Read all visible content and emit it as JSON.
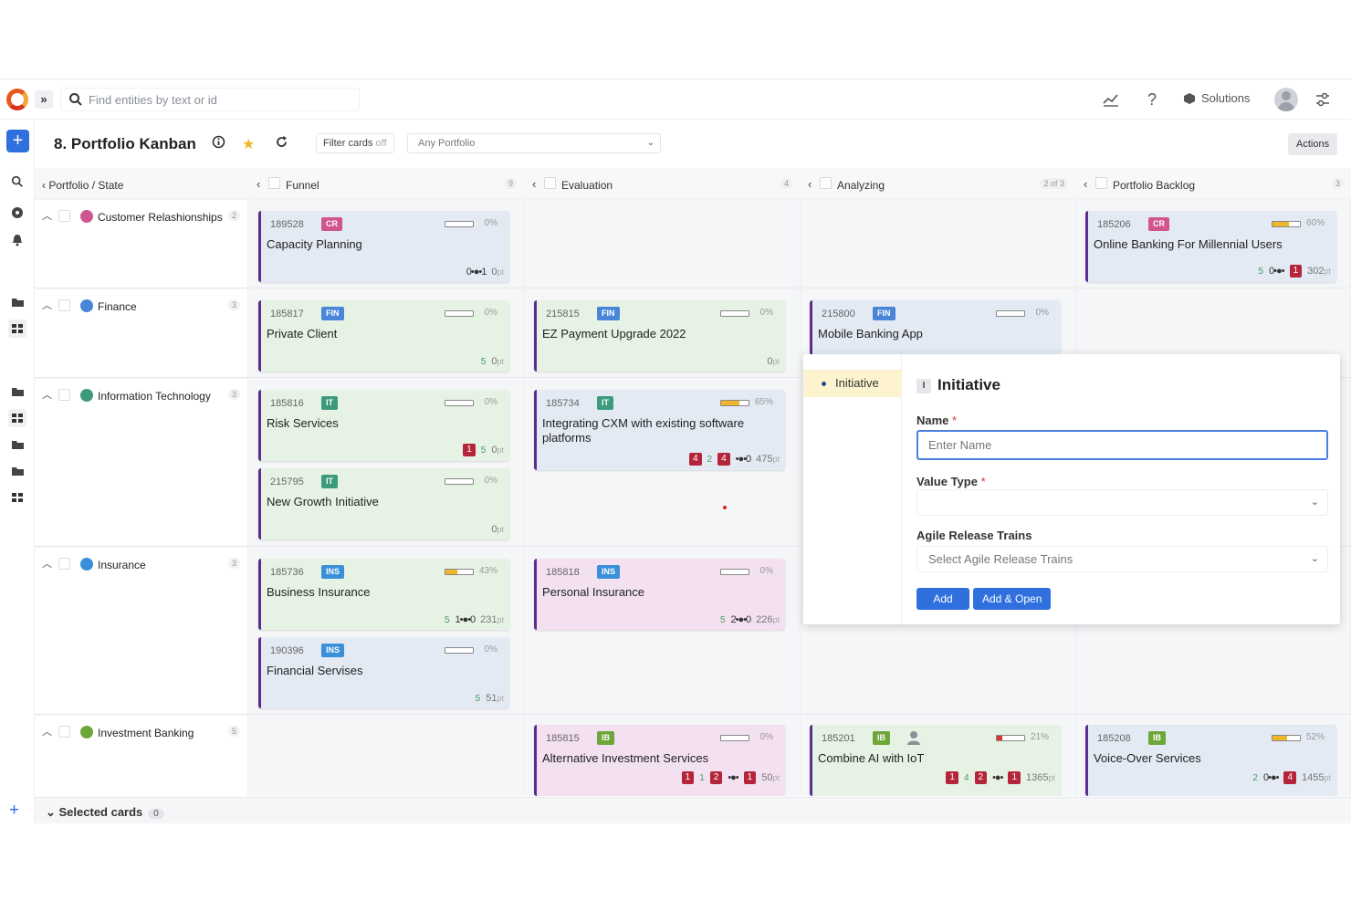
{
  "topbar": {
    "search_placeholder": "Find entities by text or id",
    "solutions_label": "Solutions",
    "icons": [
      "logo-icon",
      "expand-icon",
      "search-icon",
      "chart-icon",
      "help-icon",
      "solutions-icon",
      "avatar",
      "settings-icon"
    ]
  },
  "header": {
    "title": "8. Portfolio Kanban",
    "filter_label": "Filter cards",
    "filter_state": "off",
    "portfolio_select": "Any Portfolio",
    "actions_label": "Actions"
  },
  "board": {
    "row_header": "Portfolio / State",
    "columns": [
      {
        "label": "Funnel",
        "count": "9"
      },
      {
        "label": "Evaluation",
        "count": "4"
      },
      {
        "label": "Analyzing",
        "count": "2 of 3"
      },
      {
        "label": "Portfolio Backlog",
        "count": "3"
      }
    ],
    "lanes": [
      {
        "name": "Customer Relashionships",
        "count": "2",
        "color": "#d0558f"
      },
      {
        "name": "Finance",
        "count": "3",
        "color": "#4a86d8"
      },
      {
        "name": "Information Technology",
        "count": "3",
        "color": "#3e9a7c"
      },
      {
        "name": "Insurance",
        "count": "3",
        "color": "#3a8fd9"
      },
      {
        "name": "Investment Banking",
        "count": "5",
        "color": "#6ea63a"
      }
    ]
  },
  "cards": [
    {
      "id": "189528",
      "tag": "CR",
      "tag_color": "#d0558f",
      "pct": "0%",
      "progress": 0,
      "title": "Capacity Planning",
      "chain": "0•●•1",
      "points": "0",
      "unit": "pt"
    },
    {
      "id": "185206",
      "tag": "CR",
      "tag_color": "#d0558f",
      "pct": "60%",
      "progress": 60,
      "title": "Online Banking For Millennial Users",
      "g": "5",
      "chain": "0•●•",
      "red": "1",
      "points": "302",
      "unit": "pt"
    },
    {
      "id": "185817",
      "tag": "FIN",
      "tag_color": "#4a86d8",
      "pct": "0%",
      "progress": 0,
      "title": "Private Client",
      "g": "5",
      "points": "0",
      "unit": "pt"
    },
    {
      "id": "215815",
      "tag": "FIN",
      "tag_color": "#4a86d8",
      "pct": "0%",
      "progress": 0,
      "title": "EZ Payment Upgrade 2022",
      "points": "0",
      "unit": "pt"
    },
    {
      "id": "215800",
      "tag": "FIN",
      "tag_color": "#4a86d8",
      "pct": "0%",
      "progress": 0,
      "title": "Mobile Banking App"
    },
    {
      "id": "185816",
      "tag": "IT",
      "tag_color": "#3e9a7c",
      "pct": "0%",
      "progress": 0,
      "title": "Risk Services",
      "red1": "1",
      "g": "5",
      "points": "0",
      "unit": "pt"
    },
    {
      "id": "185734",
      "tag": "IT",
      "tag_color": "#3e9a7c",
      "pct": "65%",
      "progress": 65,
      "title": "Integrating CXM with existing software platforms",
      "red1": "4",
      "g": "2",
      "red2": "4",
      "chain": "•●•0",
      "points": "475",
      "unit": "pt"
    },
    {
      "id": "215795",
      "tag": "IT",
      "tag_color": "#3e9a7c",
      "pct": "0%",
      "progress": 0,
      "title": "New Growth Initiative",
      "points": "0",
      "unit": "pt"
    },
    {
      "id": "185736",
      "tag": "INS",
      "tag_color": "#3a8fd9",
      "pct": "43%",
      "progress": 43,
      "title": "Business Insurance",
      "g": "5",
      "chain": "1•●•0",
      "points": "231",
      "unit": "pt"
    },
    {
      "id": "185818",
      "tag": "INS",
      "tag_color": "#3a8fd9",
      "pct": "0%",
      "progress": 0,
      "title": "Personal Insurance",
      "g": "5",
      "chain": "2•●•0",
      "points": "226",
      "unit": "pt"
    },
    {
      "id": "190396",
      "tag": "INS",
      "tag_color": "#3a8fd9",
      "pct": "0%",
      "progress": 0,
      "title": "Financial Servises",
      "g": "5",
      "points": "51",
      "unit": "pt"
    },
    {
      "id": "185815",
      "tag": "IB",
      "tag_color": "#6ea63a",
      "pct": "0%",
      "progress": 0,
      "title": "Alternative Investment Services",
      "red1": "1",
      "g": "1",
      "red2": "2",
      "chain": "•●•",
      "red3": "1",
      "points": "50",
      "unit": "pt"
    },
    {
      "id": "185201",
      "tag": "IB",
      "tag_color": "#6ea63a",
      "pct": "21%",
      "progress": 21,
      "title": "Combine AI with IoT",
      "red1": "1",
      "g": "4",
      "red2": "2",
      "chain": "•●•",
      "red3": "1",
      "points": "1365",
      "unit": "pt"
    },
    {
      "id": "185208",
      "tag": "IB",
      "tag_color": "#6ea63a",
      "pct": "52%",
      "progress": 52,
      "title": "Voice-Over Services",
      "g": "2",
      "chain": "0•●•",
      "red3": "4",
      "points": "1455",
      "unit": "pt"
    }
  ],
  "popup": {
    "side_item": "Initiative",
    "title_badge": "I",
    "title": "Initiative",
    "name_label": "Name",
    "name_placeholder": "Enter Name",
    "value_type_label": "Value Type",
    "value_type_value": "",
    "art_label": "Agile Release Trains",
    "art_placeholder": "Select Agile Release Trains",
    "add_label": "Add",
    "add_open_label": "Add & Open",
    "required_mark": "*"
  },
  "footer": {
    "selected_label": "Selected cards",
    "selected_count": "0"
  }
}
